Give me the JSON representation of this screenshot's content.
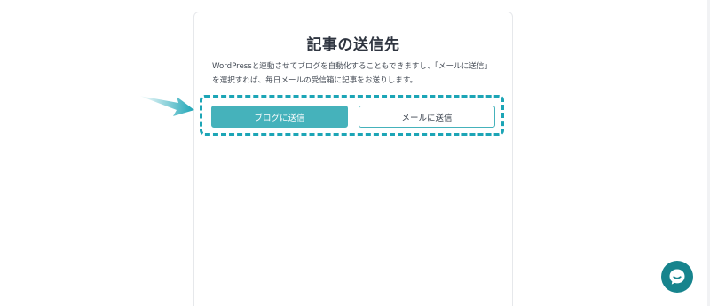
{
  "card": {
    "title": "記事の送信先",
    "description": "WordPressと連動させてブログを自動化することもできますし、「メールに送信」を選択すれば、毎日メールの受信箱に記事をお送りします。"
  },
  "buttons": {
    "send_to_blog": "ブログに送信",
    "send_to_email": "メールに送信"
  },
  "colors": {
    "accent": "#45b2bb",
    "highlight_dash": "#1ca5b6",
    "chat_button": "#17848d"
  },
  "icons": {
    "pointer_arrow": "arrow-right-icon",
    "chat": "chat-icon"
  }
}
